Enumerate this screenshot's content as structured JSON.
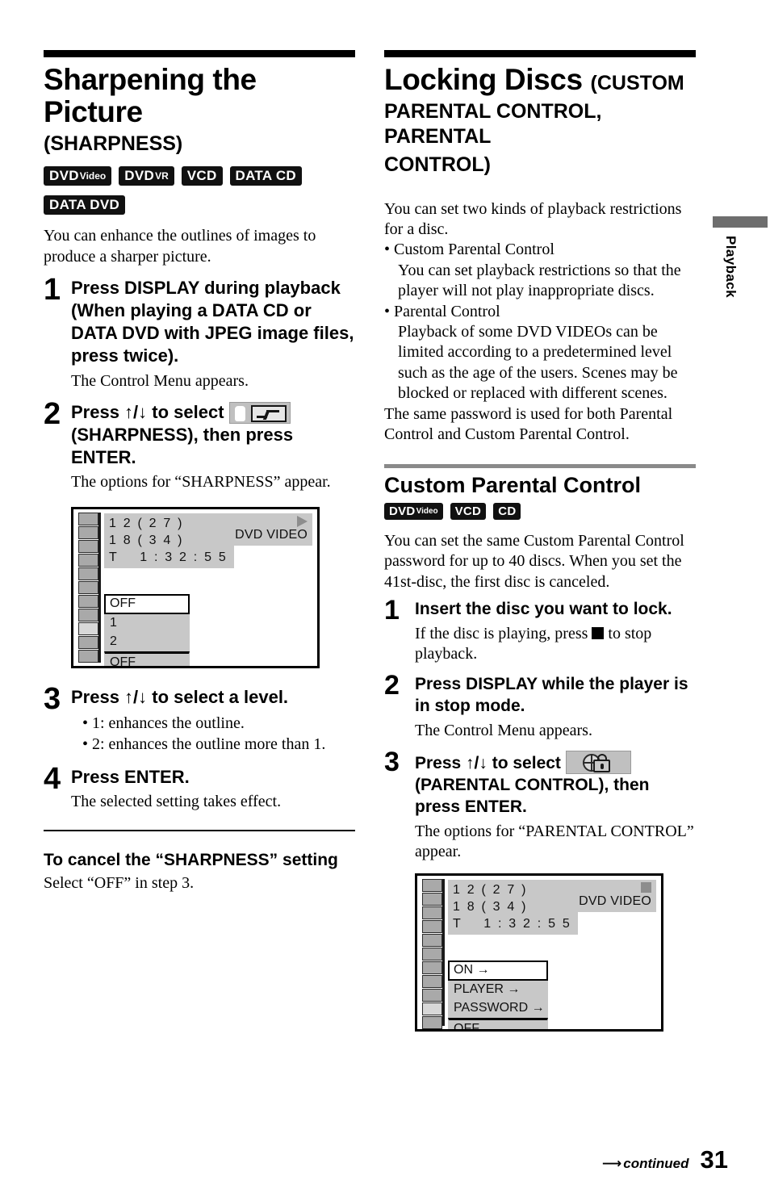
{
  "left": {
    "title": "Sharpening the Picture",
    "subtitle": "(SHARPNESS)",
    "badges": [
      {
        "main": "DVD",
        "small": "Video"
      },
      {
        "main": "DVD",
        "small": "VR"
      },
      {
        "main": "VCD",
        "small": ""
      },
      {
        "main": "DATA CD",
        "small": ""
      },
      {
        "main": "DATA DVD",
        "small": ""
      }
    ],
    "intro": "You can enhance the outlines of images to produce a sharper picture.",
    "steps": [
      {
        "num": "1",
        "head": "Press DISPLAY during playback (When playing a DATA CD or DATA DVD with JPEG image files, press twice).",
        "note": "The Control Menu appears."
      },
      {
        "num": "2",
        "head_a": "Press ↑/↓ to select",
        "head_b": "(SHARPNESS), then press ENTER.",
        "note": "The options for “SHARPNESS” appear."
      },
      {
        "num": "3",
        "head": "Press ↑/↓ to select a level.",
        "bullets": [
          "• 1: enhances the outline.",
          "• 2: enhances the outline more than 1."
        ]
      },
      {
        "num": "4",
        "head": "Press ENTER.",
        "note": "The selected setting takes effect."
      }
    ],
    "cancel_head": "To cancel the “SHARPNESS” setting",
    "cancel_body": "Select “OFF” in step 3.",
    "screen": {
      "info_line1": "1 2 ( 2 7 )",
      "info_line2": "1 8 ( 3 4 )",
      "info_line3": "T    1 : 3 2 : 5 5",
      "disc_label": "DVD VIDEO",
      "play_state": "play",
      "menu": [
        "OFF",
        "1",
        "2"
      ],
      "current": "OFF",
      "cell_count": 11,
      "highlight_cell": 9
    }
  },
  "right": {
    "title_main": "Locking Discs",
    "title_paren": "(CUSTOM",
    "title_line2": "PARENTAL CONTROL, PARENTAL",
    "title_line3": "CONTROL)",
    "intro": "You can set two kinds of playback restrictions for a disc.",
    "bullets": [
      {
        "title": "• Custom Parental Control",
        "text": "You can set playback restrictions so that the player will not play inappropriate discs."
      },
      {
        "title": "• Parental Control",
        "text": "Playback of some DVD VIDEOs can be limited according to a predetermined level such as the age of the users. Scenes may be blocked or replaced with different scenes."
      }
    ],
    "closing": "The same password is used for both Parental Control and Custom Parental Control.",
    "section_title": "Custom Parental Control",
    "section_badges": [
      {
        "main": "DVD",
        "small": "Video"
      },
      {
        "main": "VCD",
        "small": ""
      },
      {
        "main": "CD",
        "small": ""
      }
    ],
    "section_intro": "You can set the same Custom Parental Control password for up to 40 discs. When you set the 41st-disc, the first disc is canceled.",
    "steps": [
      {
        "num": "1",
        "head": "Insert the disc you want to lock.",
        "note_a": "If the disc is playing, press",
        "note_b": "to stop playback."
      },
      {
        "num": "2",
        "head": "Press DISPLAY while the player is in stop mode.",
        "note": "The Control Menu appears."
      },
      {
        "num": "3",
        "head_a": "Press ↑/↓ to select",
        "head_b": "(PARENTAL CONTROL), then press ENTER.",
        "note": "The options for “PARENTAL CONTROL” appear."
      }
    ],
    "screen": {
      "info_line1": "1 2 ( 2 7 )",
      "info_line2": "1 8 ( 3 4 )",
      "info_line3": "T    1 : 3 2 : 5 5",
      "disc_label": "DVD VIDEO",
      "play_state": "stop",
      "menu": [
        "ON →",
        "PLAYER →",
        "PASSWORD →"
      ],
      "current": "OFF",
      "cell_count": 11,
      "highlight_cell": 10
    }
  },
  "sidetab": {
    "label": "Playback"
  },
  "footer": {
    "continued": "continued",
    "page_number": "31"
  }
}
